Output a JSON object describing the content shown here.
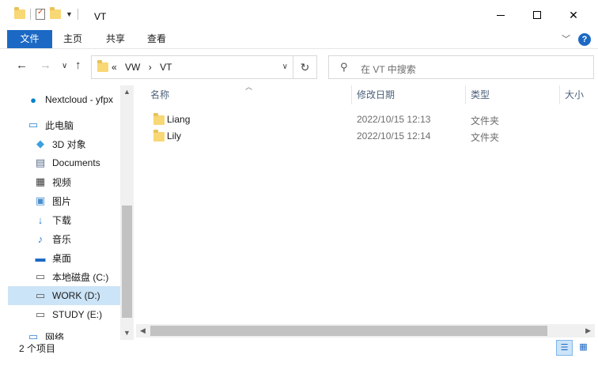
{
  "window": {
    "title": "VT"
  },
  "ribbon": {
    "tabs": [
      "文件",
      "主页",
      "共享",
      "查看"
    ]
  },
  "nav": {
    "path": [
      "VW",
      "VT"
    ],
    "path_prefix": "«",
    "search_placeholder": "在 VT 中搜索"
  },
  "sidebar": {
    "items": [
      {
        "label": "Nextcloud - yfpx",
        "icon": "nextcloud-icon"
      },
      {
        "label": "此电脑",
        "icon": "computer-icon"
      },
      {
        "label": "3D 对象",
        "icon": "cube-3d-icon"
      },
      {
        "label": "Documents",
        "icon": "document-icon"
      },
      {
        "label": "视频",
        "icon": "video-icon"
      },
      {
        "label": "图片",
        "icon": "picture-icon"
      },
      {
        "label": "下载",
        "icon": "download-icon"
      },
      {
        "label": "音乐",
        "icon": "music-icon"
      },
      {
        "label": "桌面",
        "icon": "desktop-icon"
      },
      {
        "label": "本地磁盘 (C:)",
        "icon": "drive-icon"
      },
      {
        "label": "WORK (D:)",
        "icon": "drive-icon",
        "selected": true
      },
      {
        "label": "STUDY (E:)",
        "icon": "drive-icon"
      },
      {
        "label": "网络",
        "icon": "network-icon"
      }
    ]
  },
  "content": {
    "columns": [
      "名称",
      "修改日期",
      "类型",
      "大小"
    ],
    "rows": [
      {
        "name": "Liang",
        "date": "2022/10/15 12:13",
        "type": "文件夹"
      },
      {
        "name": "Lily",
        "date": "2022/10/15 12:14",
        "type": "文件夹"
      }
    ]
  },
  "status": {
    "count_text": "2 个项目"
  },
  "colors": {
    "accent": "#1b69c4",
    "selection": "#cce4f7",
    "folder": "#f8d775"
  }
}
